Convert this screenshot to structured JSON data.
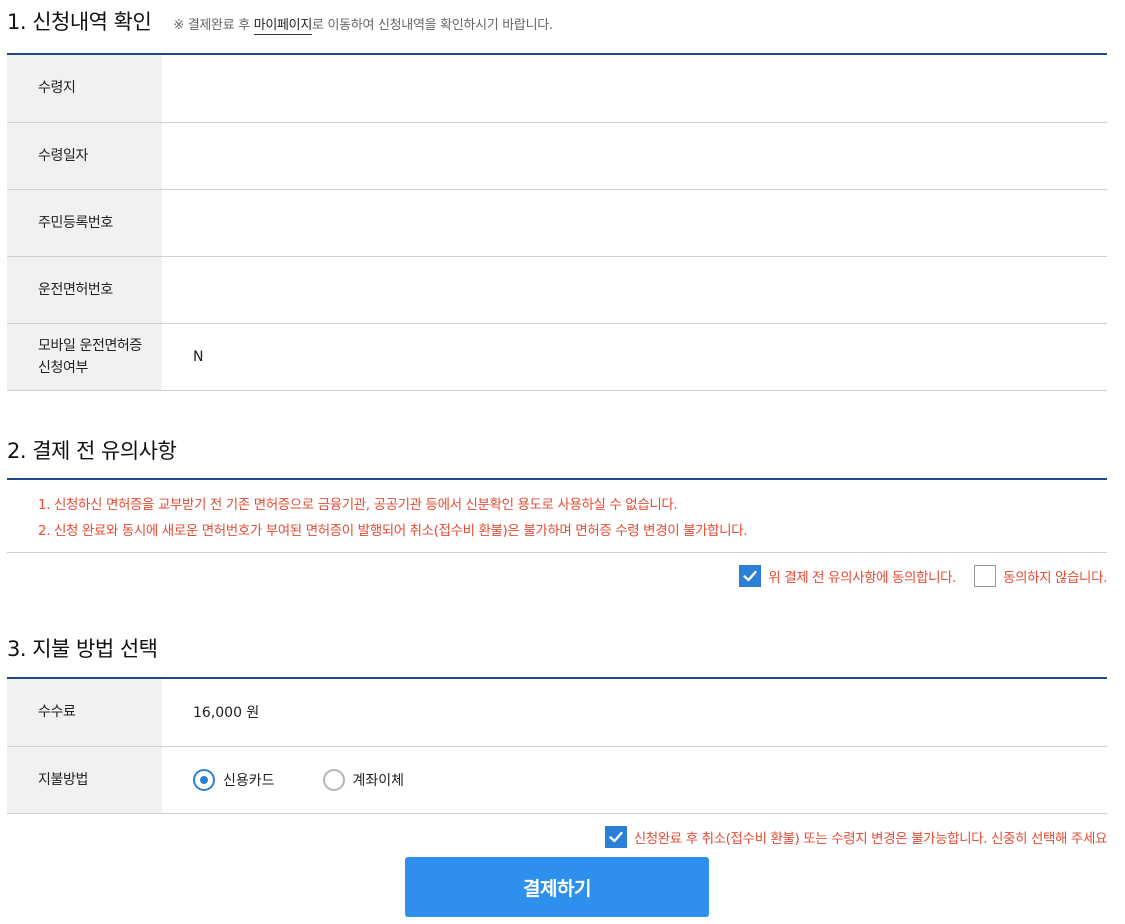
{
  "section1": {
    "title": "1. 신청내역 확인",
    "notice_prefix": "※ 결제완료 후 ",
    "notice_link": "마이페이지",
    "notice_suffix": "로 이동하여 신청내역을 확인하시기 바랍니다.",
    "rows": [
      {
        "label": "수령지",
        "value": ""
      },
      {
        "label": "수령일자",
        "value": ""
      },
      {
        "label": "주민등록번호",
        "value": ""
      },
      {
        "label": "운전면허번호",
        "value": ""
      },
      {
        "label_line1": "모바일 운전면허증",
        "label_line2": "신청여부",
        "value": "N"
      }
    ]
  },
  "section2": {
    "title": "2. 결제 전 유의사항",
    "notices": [
      "1. 신청하신 면허증을 교부받기 전 기존 면허증으로 금융기관, 공공기관 등에서 신분확인 용도로 사용하실 수 없습니다.",
      "2. 신청 완료와 동시에 새로운 면허번호가 부여된 면허증이 발행되어 취소(접수비 환불)은 불가하며 면허증 수령 변경이 불가합니다."
    ],
    "agree_label": "위 결제 전 유의사항에 동의합니다.",
    "agree_checked": true,
    "disagree_label": "동의하지 않습니다.",
    "disagree_checked": false
  },
  "section3": {
    "title": "3. 지불 방법 선택",
    "fee_label": "수수료",
    "fee_value": "16,000 원",
    "method_label": "지불방법",
    "methods": [
      {
        "label": "신용카드",
        "selected": true
      },
      {
        "label": "계좌이체",
        "selected": false
      }
    ],
    "final_agree_label": "신청완료 후 취소(접수비 환불) 또는 수령지 변경은 불가능합니다. 신중히 선택해 주세요",
    "final_agree_checked": true
  },
  "pay_button_label": "결제하기",
  "colors": {
    "accent_rule": "#1f4a8c",
    "warning_text": "#e44c34",
    "primary_button": "#2e90ec",
    "checkbox_blue": "#2b7fd6",
    "header_cell_bg": "#f1f1f1"
  }
}
